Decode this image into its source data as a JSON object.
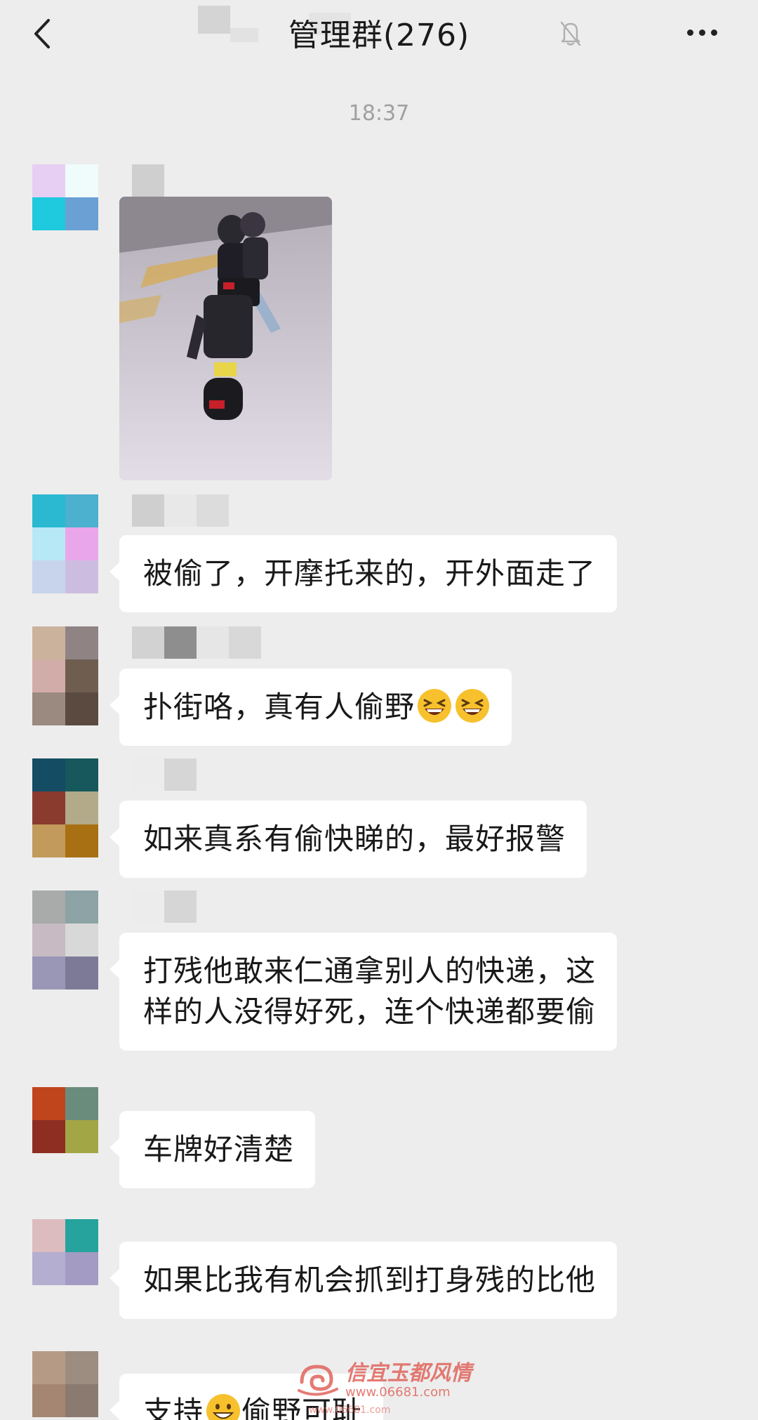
{
  "header": {
    "title": "管理群(276)",
    "mute_icon": "bell-off-icon",
    "back_icon": "chevron-left-icon",
    "more_icon": "more-dots-icon"
  },
  "timestamp": "18:37",
  "messages": [
    {
      "type": "image",
      "image": "photo-motorcycle-thief"
    },
    {
      "type": "text",
      "text": "被偷了，开摩托来的，开外面走了"
    },
    {
      "type": "text",
      "text": "扑街咯，真有人偷野",
      "emoji": [
        "grinning-squint-icon",
        "grinning-squint-icon"
      ]
    },
    {
      "type": "text",
      "text": "如来真系有偷快睇的，最好报警"
    },
    {
      "type": "text",
      "lines": [
        "打残他敢来仁通拿别人的快递，这",
        "样的人没得好死，连个快递都要偷"
      ]
    },
    {
      "type": "text",
      "text": "车牌好清楚"
    },
    {
      "type": "text",
      "text": "如果比我有机会抓到打身残的比他"
    },
    {
      "type": "text",
      "prefix": "支持",
      "suffix": "偷野可耻",
      "emoji": [
        "grinning-icon"
      ]
    }
  ],
  "watermark": {
    "brand": "信宜玉都风情",
    "url": "www.06681.com",
    "url_small": "www.06681.com"
  },
  "colors": {
    "background": "#ededed",
    "bubble": "#ffffff",
    "timestamp": "#a0a0a0",
    "watermark": "#e0645c"
  }
}
